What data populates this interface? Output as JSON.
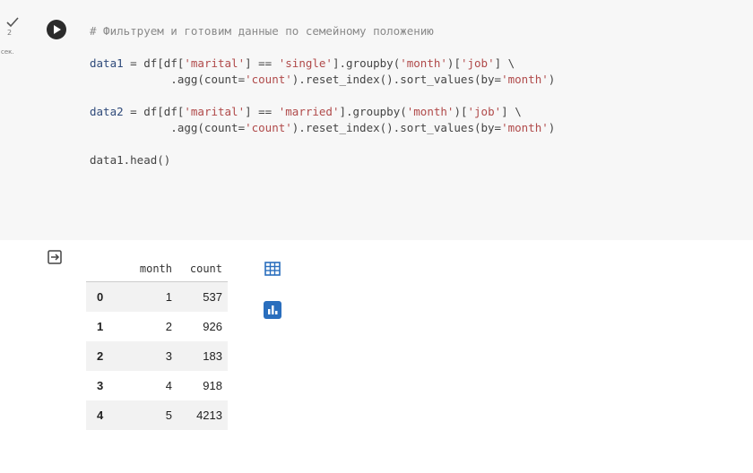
{
  "cell": {
    "status_icon": "check-icon",
    "exec_time": "2",
    "exec_unit": "сек.",
    "run_icon": "play-icon",
    "code_lines": [
      {
        "parts": [
          {
            "t": "# Фильтруем и готовим данные по семейному положению",
            "c": "comment"
          }
        ]
      },
      {
        "parts": [
          {
            "t": "data1",
            "c": "name"
          },
          {
            "t": " = df[df[",
            "c": "op"
          },
          {
            "t": "'marital'",
            "c": "str"
          },
          {
            "t": "] == ",
            "c": "op"
          },
          {
            "t": "'single'",
            "c": "str"
          },
          {
            "t": "].groupby(",
            "c": "op"
          },
          {
            "t": "'month'",
            "c": "str"
          },
          {
            "t": ")[",
            "c": "op"
          },
          {
            "t": "'job'",
            "c": "str"
          },
          {
            "t": "] \\",
            "c": "op"
          }
        ]
      },
      {
        "parts": [
          {
            "t": "            .agg(count=",
            "c": "op"
          },
          {
            "t": "'count'",
            "c": "str"
          },
          {
            "t": ").reset_index().sort_values(by=",
            "c": "op"
          },
          {
            "t": "'month'",
            "c": "str"
          },
          {
            "t": ")",
            "c": "op"
          }
        ]
      },
      {
        "parts": [
          {
            "t": "data2",
            "c": "name"
          },
          {
            "t": " = df[df[",
            "c": "op"
          },
          {
            "t": "'marital'",
            "c": "str"
          },
          {
            "t": "] == ",
            "c": "op"
          },
          {
            "t": "'married'",
            "c": "str"
          },
          {
            "t": "].groupby(",
            "c": "op"
          },
          {
            "t": "'month'",
            "c": "str"
          },
          {
            "t": ")[",
            "c": "op"
          },
          {
            "t": "'job'",
            "c": "str"
          },
          {
            "t": "] \\",
            "c": "op"
          }
        ]
      },
      {
        "parts": [
          {
            "t": "            .agg(count=",
            "c": "op"
          },
          {
            "t": "'count'",
            "c": "str"
          },
          {
            "t": ").reset_index().sort_values(by=",
            "c": "op"
          },
          {
            "t": "'month'",
            "c": "str"
          },
          {
            "t": ")",
            "c": "op"
          }
        ]
      },
      {
        "parts": [
          {
            "t": "data1.head()",
            "c": "op"
          }
        ]
      }
    ]
  },
  "output": {
    "output_icon": "output-arrow-icon",
    "table": {
      "columns": [
        "",
        "month",
        "count"
      ],
      "rows": [
        [
          "0",
          "1",
          "537"
        ],
        [
          "1",
          "2",
          "926"
        ],
        [
          "2",
          "3",
          "183"
        ],
        [
          "3",
          "4",
          "918"
        ],
        [
          "4",
          "5",
          "4213"
        ]
      ]
    },
    "table_button_icon": "table-grid-icon",
    "chart_button_icon": "bar-chart-icon",
    "accent_color": "#2a6ebd"
  }
}
